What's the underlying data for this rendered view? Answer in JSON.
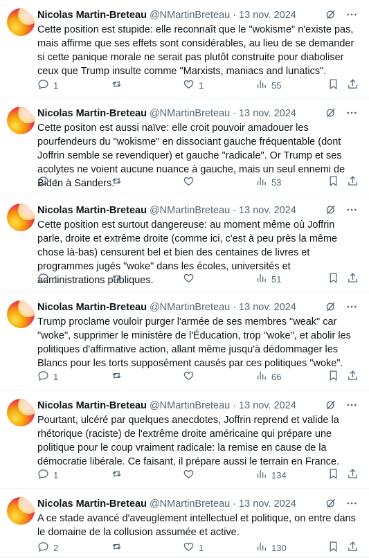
{
  "tweets": [
    {
      "name": "Nicolas Martin-Breteau",
      "handle": "@NMartinBreteau",
      "dot": "·",
      "date": "13 nov. 2024",
      "text": "Cette position est stupide: elle reconnaît que le \"wokisme\" n'existe pas, mais affirme que ses effets sont considérables, au lieu de se demander si cette panique morale ne serait pas plutôt construite pour diaboliser ceux que Trump insulte comme \"Marxists, maniacs and lunatics\".",
      "replies": "1",
      "retweets": "",
      "likes": "1",
      "views": "55"
    },
    {
      "name": "Nicolas Martin-Breteau",
      "handle": "@NMartinBreteau",
      "dot": "·",
      "date": "13 nov. 2024",
      "text": "Cette positon est aussi naïve: elle croit pouvoir amadouer les pourfendeurs du \"wokisme\" en dissociant gauche fréquentable (dont Joffrin semble se revendiquer) et gauche \"radicale\". Or Trump et ses acolytes ne voient aucune nuance à gauche, mais un seul ennemi de Biden à Sanders.",
      "replies": "1",
      "retweets": "",
      "likes": "",
      "views": "53"
    },
    {
      "name": "Nicolas Martin-Breteau",
      "handle": "@NMartinBreteau",
      "dot": "·",
      "date": "13 nov. 2024",
      "text": "Cette position est surtout dangereuse: au moment même où Joffrin parle, droite et extrême droite (comme ici, c'est à peu près la même chose là-bas) censurent bel et bien des centaines de livres et programmes jugés \"woke\" dans les écoles, universités et administrations publiques.",
      "replies": "1",
      "retweets": "",
      "likes": "",
      "views": "51"
    },
    {
      "name": "Nicolas Martin-Breteau",
      "handle": "@NMartinBreteau",
      "dot": "·",
      "date": "13 nov. 2024",
      "text": "Trump proclame vouloir purger l'armée de ses membres \"weak\" car \"woke\", supprimer le ministère de l'Éducation, trop \"woke\", et abolir les politiques d'affirmative action, allant même jusqu'à dédommager les Blancs pour les torts supposément causés par ces politiques \"woke\".",
      "replies": "1",
      "retweets": "",
      "likes": "",
      "views": "66"
    },
    {
      "name": "Nicolas Martin-Breteau",
      "handle": "@NMartinBreteau",
      "dot": "·",
      "date": "13 nov. 2024",
      "text": "Pourtant, ulcéré par quelques anecdotes, Joffrin reprend et valide la rhétorique (raciste) de l'extrême droite américaine qui prépare une politique pour le coup vraiment radicale: la remise en cause de la démocratie libérale. Ce faisant, il prépare aussi le terrain en France.",
      "replies": "1",
      "retweets": "",
      "likes": "",
      "views": "134"
    },
    {
      "name": "Nicolas Martin-Breteau",
      "handle": "@NMartinBreteau",
      "dot": "·",
      "date": "13 nov. 2024",
      "text": "A ce stade avancé d'aveuglement intellectuel et politique, on entre dans le domaine de la collusion assumée et active.",
      "replies": "2",
      "retweets": "",
      "likes": "1",
      "views": "130"
    }
  ]
}
